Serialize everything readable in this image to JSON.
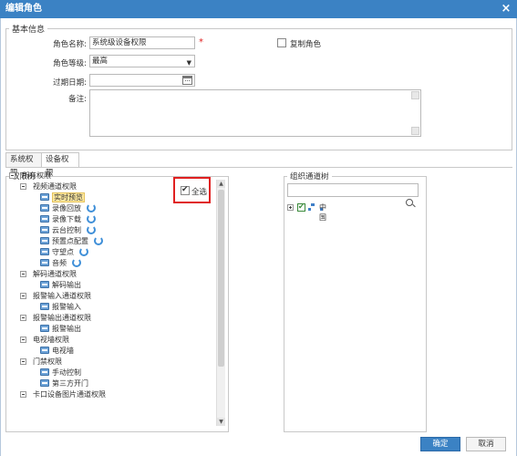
{
  "window": {
    "title": "编辑角色",
    "close_glyph": "×"
  },
  "basic": {
    "legend": "基本信息",
    "role_name_label": "角色名称:",
    "role_name_value": "系统级设备权限",
    "required_mark": "*",
    "copy_role_label": "复制角色",
    "role_level_label": "角色等级:",
    "role_level_value": "最高",
    "expiry_label": "过期日期:",
    "expiry_value": "",
    "note_label": "备注:",
    "note_value": ""
  },
  "tabs": [
    {
      "label": "系统权限",
      "active": false
    },
    {
      "label": "设备权限",
      "active": true
    }
  ],
  "permission_tree": {
    "legend": "权限树",
    "select_all_label": "全选",
    "select_all_checked": true,
    "nodes": [
      {
        "label": "所有权限"
      },
      {
        "label": "视频通道权限"
      },
      {
        "label": "实时预览"
      },
      {
        "label": "录像回放"
      },
      {
        "label": "录像下载"
      },
      {
        "label": "云台控制"
      },
      {
        "label": "预置点配置"
      },
      {
        "label": "守望点"
      },
      {
        "label": "音频"
      },
      {
        "label": "解码通道权限"
      },
      {
        "label": "解码输出"
      },
      {
        "label": "报警输入通道权限"
      },
      {
        "label": "报警输入"
      },
      {
        "label": "报警输出通道权限"
      },
      {
        "label": "报警输出"
      },
      {
        "label": "电视墙权限"
      },
      {
        "label": "电视墙"
      },
      {
        "label": "门禁权限"
      },
      {
        "label": "手动控制"
      },
      {
        "label": "第三方开门"
      },
      {
        "label": "卡口设备图片通道权限"
      }
    ]
  },
  "org_tree": {
    "legend": "组织通道树",
    "search_value": "",
    "root_label": "中国",
    "root_checked": true
  },
  "footer": {
    "confirm_label": "确定",
    "cancel_label": "取消"
  },
  "colors": {
    "accent": "#3b82c4",
    "highlight": "#ffeaa0",
    "required": "#e02020"
  }
}
